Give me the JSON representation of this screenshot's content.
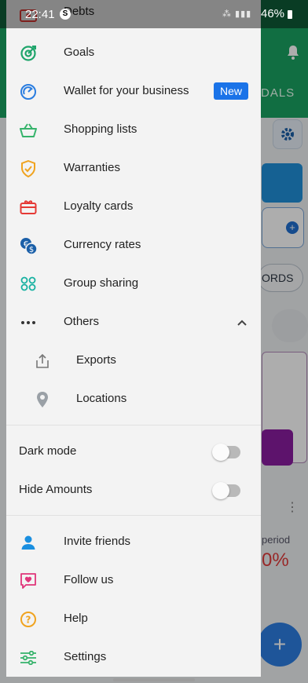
{
  "status_bar": {
    "time": "22:41",
    "battery": "46%"
  },
  "background": {
    "tab_fragment": "DALS",
    "button_fragment": "ORDS",
    "period_fragment": "period",
    "percent_fragment": "0%"
  },
  "drawer": {
    "partial_top_item": "Debts",
    "items": [
      {
        "label": "Goals",
        "icon": "target-icon",
        "color": "#1fa56b"
      },
      {
        "label": "Wallet for your business",
        "icon": "gauge-icon",
        "color": "#2a7de0",
        "badge": "New"
      },
      {
        "label": "Shopping lists",
        "icon": "basket-icon",
        "color": "#36b36b"
      },
      {
        "label": "Warranties",
        "icon": "shield-check-icon",
        "color": "#f0a31f"
      },
      {
        "label": "Loyalty cards",
        "icon": "gift-card-icon",
        "color": "#e53935"
      },
      {
        "label": "Currency rates",
        "icon": "currency-exchange-icon",
        "color": "#1a5fa8"
      },
      {
        "label": "Group sharing",
        "icon": "group-icon",
        "color": "#17b1a1"
      }
    ],
    "others": {
      "label": "Others",
      "expanded": true,
      "children": [
        {
          "label": "Exports",
          "icon": "export-icon"
        },
        {
          "label": "Locations",
          "icon": "location-pin-icon"
        }
      ]
    },
    "toggles": [
      {
        "label": "Dark mode",
        "on": false
      },
      {
        "label": "Hide Amounts",
        "on": false
      }
    ],
    "footer_items": [
      {
        "label": "Invite friends",
        "icon": "person-add-icon",
        "color": "#1a8fe0"
      },
      {
        "label": "Follow us",
        "icon": "heart-message-icon",
        "color": "#e0357a"
      },
      {
        "label": "Help",
        "icon": "help-icon",
        "color": "#f0a31f"
      },
      {
        "label": "Settings",
        "icon": "sliders-icon",
        "color": "#36b36b"
      }
    ]
  }
}
